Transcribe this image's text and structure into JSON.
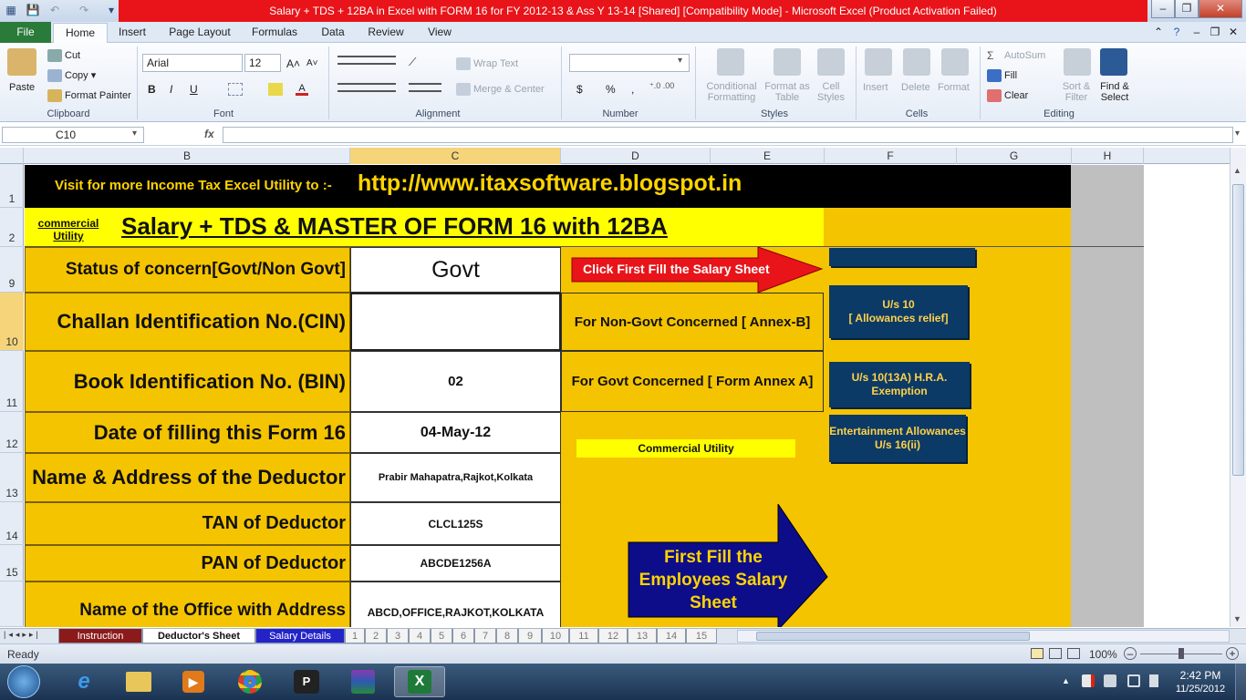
{
  "window": {
    "title": "Salary + TDS + 12BA in Excel with FORM 16 for FY 2012-13 & Ass Y 13-14  [Shared]  [Compatibility Mode]  -  Microsoft Excel (Product Activation Failed)",
    "minimize": "–",
    "restore": "❐",
    "close": "✕"
  },
  "ribbon": {
    "tabs": [
      "File",
      "Home",
      "Insert",
      "Page Layout",
      "Formulas",
      "Data",
      "Review",
      "View"
    ],
    "clipboard": {
      "paste": "Paste",
      "cut": "Cut",
      "copy": "Copy ▾",
      "format_painter": "Format Painter",
      "label": "Clipboard"
    },
    "font": {
      "name": "Arial",
      "size": "12",
      "grow": "A˄",
      "shrink": "A˅",
      "bold": "B",
      "italic": "I",
      "underline": "U",
      "label": "Font"
    },
    "alignment": {
      "wrap": "Wrap Text",
      "merge": "Merge & Center",
      "label": "Alignment"
    },
    "number": {
      "format": "",
      "currency": "$",
      "percent": "%",
      "comma": ",",
      "label": "Number"
    },
    "styles": {
      "conditional": "Conditional Formatting",
      "table": "Format as Table",
      "cell": "Cell Styles",
      "label": "Styles"
    },
    "cells": {
      "insert": "Insert",
      "delete": "Delete",
      "format": "Format",
      "label": "Cells"
    },
    "editing": {
      "autosum": "AutoSum",
      "fill": "Fill",
      "clear": "Clear",
      "sort": "Sort & Filter",
      "find": "Find & Select",
      "label": "Editing"
    }
  },
  "formula_bar": {
    "name_box": "C10",
    "fx": "fx",
    "formula": ""
  },
  "columns": [
    "B",
    "C",
    "D",
    "E",
    "F",
    "G",
    "H"
  ],
  "rows": [
    "1",
    "2",
    "9",
    "10",
    "11",
    "12",
    "13",
    "14",
    "15",
    ""
  ],
  "sheet": {
    "visit_text": "Visit for more Income Tax Excel Utility to :-",
    "url": "http://www.itaxsoftware.blogspot.in",
    "commercial_link": "commercial Utility",
    "main_title": "Salary + TDS & MASTER OF FORM 16 with 12BA",
    "fields": [
      {
        "label": "Status of concern[Govt/Non Govt]",
        "value": "Govt"
      },
      {
        "label": "Challan Identification No.(CIN)",
        "value": ""
      },
      {
        "label": "Book Identification No. (BIN)",
        "value": "02"
      },
      {
        "label": "Date of filling this Form 16",
        "value": "04-May-12"
      },
      {
        "label": "Name & Address of the Deductor",
        "value": "Prabir Mahapatra,Rajkot,Kolkata"
      },
      {
        "label": "TAN of Deductor",
        "value": "CLCL125S"
      },
      {
        "label": "PAN of Deductor",
        "value": "ABCDE1256A"
      },
      {
        "label": "Name of the Office with Address",
        "value": "ABCD,OFFICE,RAJKOT,KOLKATA"
      }
    ],
    "click_arrow": "Click First Fill the Salary Sheet",
    "non_govt": "For Non-Govt Concerned [ Annex-B]",
    "govt": "For Govt Concerned [ Form Annex A]",
    "commercial_utility": "Commercial Utility",
    "btn_allowances": "U/s 10\n[ Allowances relief]",
    "btn_hra": "U/s 10(13A)  H.R.A. Exemption",
    "btn_entertainment": "Entertainment Allowances U/s 16(ii)",
    "big_arrow": "First Fill the Employees Salary Sheet"
  },
  "sheet_tabs": [
    "Instruction",
    "Deductor's Sheet",
    "Salary Details",
    "1",
    "2",
    "3",
    "4",
    "5",
    "6",
    "7",
    "8",
    "9",
    "10",
    "11",
    "12",
    "13",
    "14",
    "15"
  ],
  "status": {
    "ready": "Ready",
    "zoom": "100%"
  },
  "taskbar": {
    "time": "2:42 PM",
    "date": "11/25/2012"
  },
  "colors": {
    "red_title": "#e8141a",
    "sheet_yellow": "#f5c400",
    "sheet_black": "#000000",
    "button_navy": "#0c3a66",
    "file_tab": "#2a7a3a"
  }
}
